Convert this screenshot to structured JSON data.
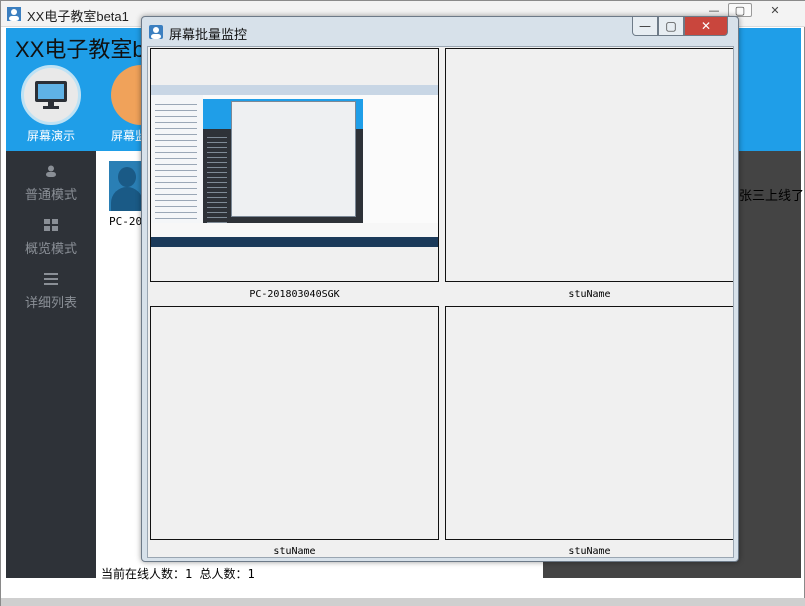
{
  "main_window": {
    "title": "XX电子教室beta1",
    "heading": "XX电子教室beta1",
    "controls": {
      "minimize": "—",
      "maximize": "▢",
      "close": "✕"
    }
  },
  "toolbar": [
    {
      "label": "屏幕演示",
      "icon": "monitor-icon"
    },
    {
      "label": "屏幕监控",
      "icon": "screen-monitor-icon"
    }
  ],
  "sidebar": {
    "items": [
      {
        "label": "普通模式",
        "icon": "user-icon"
      },
      {
        "label": "概览模式",
        "icon": "grid-icon"
      },
      {
        "label": "详细列表",
        "icon": "list-icon"
      }
    ]
  },
  "student": {
    "name": "PC-201803040SGK"
  },
  "online_message": "张三上线了",
  "status": {
    "text": "当前在线人数：1 总人数：1"
  },
  "dialog": {
    "title": "屏幕批量监控",
    "controls": {
      "minimize": "—",
      "maximize": "▢",
      "close": "✕"
    },
    "panels": [
      {
        "label": "PC-201803040SGK",
        "has_screenshot": true
      },
      {
        "label": "stuName",
        "has_screenshot": false
      },
      {
        "label": "stuName",
        "has_screenshot": false
      },
      {
        "label": "stuName",
        "has_screenshot": false
      }
    ]
  },
  "colors": {
    "header_blue": "#1f9ee8",
    "sidebar_dark": "#2e3238",
    "close_red": "#c9463d"
  }
}
